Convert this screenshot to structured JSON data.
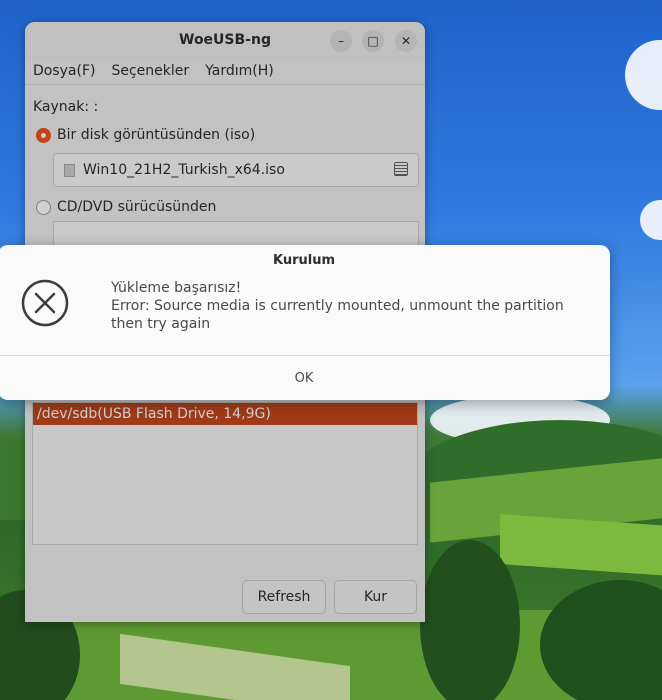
{
  "window": {
    "title": "WoeUSB-ng",
    "controls": {
      "minimize_icon": "minimize-icon",
      "maximize_icon": "maximize-icon",
      "close_icon": "close-icon"
    }
  },
  "menu": {
    "items": [
      "Dosya(F)",
      "Seçenekler",
      "Yardım(H)"
    ]
  },
  "source": {
    "label": "Kaynak: :",
    "iso_option": "Bir disk görüntüsünden (iso)",
    "iso_selected": true,
    "iso_file": "Win10_21H2_Turkish_x64.iso",
    "dvd_option": "CD/DVD sürücüsünden"
  },
  "target": {
    "devices": [
      "/dev/sdb(USB Flash Drive, 14,9G)"
    ]
  },
  "buttons": {
    "refresh": "Refresh",
    "install": "Kur"
  },
  "dialog": {
    "title": "Kurulum",
    "icon": "error-x-icon",
    "line1": "Yükleme başarısız!",
    "line2": "Error: Source media is currently mounted, unmount the partition then try again",
    "ok": "OK"
  },
  "colors": {
    "accent": "#e95420",
    "selection": "#c3481f"
  }
}
